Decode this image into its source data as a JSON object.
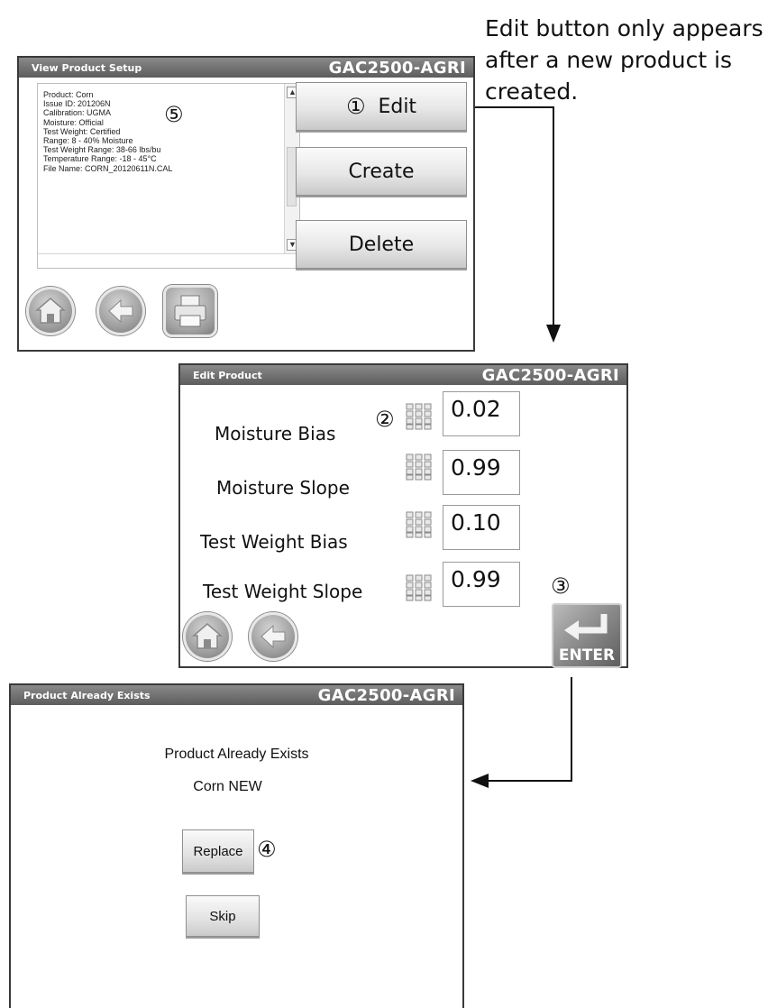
{
  "annotation": {
    "lines": [
      "Edit button only appears",
      "after a new product is",
      "created."
    ]
  },
  "view_screen": {
    "title": "View Product Setup",
    "model": "GAC2500-AGRI",
    "info_lines": [
      "Product: Corn",
      "Issue ID: 201206N",
      "Calibration: UGMA",
      "Moisture: Official",
      "Test Weight: Certified",
      "Range: 8 - 40% Moisture",
      "Test Weight Range: 38-66 lbs/bu",
      "Temperature Range: -18 - 45°C",
      "File Name: CORN_20120611N.CAL"
    ],
    "marker_info": "⑤",
    "marker_edit": "①",
    "edit_label": "Edit",
    "create_label": "Create",
    "delete_label": "Delete"
  },
  "edit_screen": {
    "title": "Edit Product",
    "model": "GAC2500-AGRI",
    "marker_keypad": "②",
    "marker_enter": "③",
    "rows": [
      {
        "label": "Moisture Bias",
        "value": "0.02"
      },
      {
        "label": "Moisture Slope",
        "value": "0.99"
      },
      {
        "label": "Test Weight Bias",
        "value": "0.10"
      },
      {
        "label": "Test Weight Slope",
        "value": "0.99"
      }
    ],
    "enter_label": "ENTER"
  },
  "exists_screen": {
    "title": "Product Already Exists",
    "model": "GAC2500-AGRI",
    "message": "Product Already Exists",
    "product": "Corn NEW",
    "replace_label": "Replace",
    "skip_label": "Skip",
    "marker_replace": "④"
  },
  "icons": {
    "home": "home-icon",
    "back": "back-arrow-icon",
    "print": "printer-icon",
    "keypad": "keypad-icon",
    "enter": "enter-icon"
  }
}
